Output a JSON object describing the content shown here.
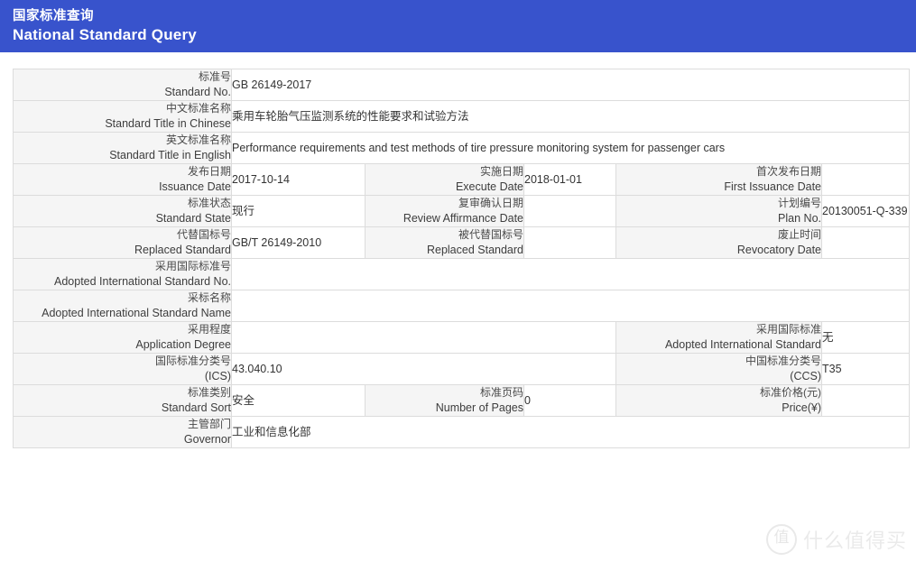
{
  "header": {
    "title_cn": "国家标准查询",
    "title_en": "National Standard Query",
    "bg_color": "#3853cc",
    "text_color": "#ffffff"
  },
  "watermark": {
    "logo_glyph": "值",
    "text": "什么值得买"
  },
  "rows": {
    "standard_no": {
      "label_cn": "标准号",
      "label_en": "Standard No.",
      "value": "GB 26149-2017"
    },
    "title_cn": {
      "label_cn": "中文标准名称",
      "label_en": "Standard Title in Chinese",
      "value": "乘用车轮胎气压监测系统的性能要求和试验方法"
    },
    "title_en": {
      "label_cn": "英文标准名称",
      "label_en": "Standard Title in English",
      "value": "Performance requirements and test methods of tire pressure monitoring system for passenger cars"
    },
    "issuance_date": {
      "label_cn": "发布日期",
      "label_en": "Issuance Date",
      "value": "2017-10-14"
    },
    "execute_date": {
      "label_cn": "实施日期",
      "label_en": "Execute Date",
      "value": "2018-01-01"
    },
    "first_issuance_date": {
      "label_cn": "首次发布日期",
      "label_en": "First Issuance Date",
      "value": ""
    },
    "standard_state": {
      "label_cn": "标准状态",
      "label_en": "Standard State",
      "value": "现行"
    },
    "review_affirmance_date": {
      "label_cn": "复审确认日期",
      "label_en": "Review Affirmance Date",
      "value": ""
    },
    "plan_no": {
      "label_cn": "计划编号",
      "label_en": "Plan No.",
      "value": "20130051-Q-339"
    },
    "replaced_standard": {
      "label_cn": "代替国标号",
      "label_en": "Replaced Standard",
      "value": "GB/T 26149-2010"
    },
    "be_replaced_standard": {
      "label_cn": "被代替国标号",
      "label_en": "Replaced Standard",
      "value": ""
    },
    "revocatory_date": {
      "label_cn": "废止时间",
      "label_en": "Revocatory Date",
      "value": ""
    },
    "adopted_intl_no": {
      "label_cn": "采用国际标准号",
      "label_en": "Adopted International Standard No.",
      "value": ""
    },
    "adopted_intl_name": {
      "label_cn": "采标名称",
      "label_en": "Adopted International Standard Name",
      "value": ""
    },
    "application_degree": {
      "label_cn": "采用程度",
      "label_en": "Application Degree",
      "value": ""
    },
    "adopted_intl_standard": {
      "label_cn": "采用国际标准",
      "label_en": "Adopted International Standard",
      "value": "无"
    },
    "ics": {
      "label_cn": "国际标准分类号",
      "label_en": "(ICS)",
      "value": "43.040.10"
    },
    "ccs": {
      "label_cn": "中国标准分类号",
      "label_en": "(CCS)",
      "value": "T35"
    },
    "standard_sort": {
      "label_cn": "标准类别",
      "label_en": "Standard Sort",
      "value": "安全"
    },
    "number_of_pages": {
      "label_cn": "标准页码",
      "label_en": "Number of Pages",
      "value": "0"
    },
    "price": {
      "label_cn": "标准价格(元)",
      "label_en": "Price(¥)",
      "value": ""
    },
    "governor": {
      "label_cn": "主管部门",
      "label_en": "Governor",
      "value": "工业和信息化部"
    }
  }
}
